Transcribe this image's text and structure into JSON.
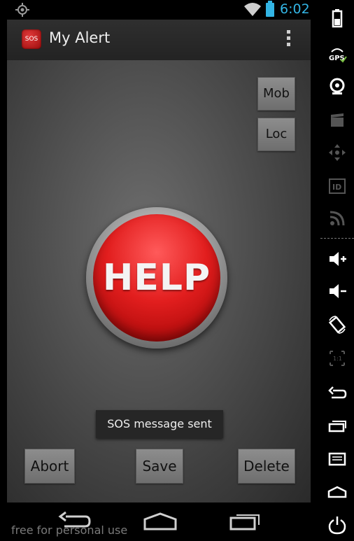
{
  "status_bar": {
    "time": "6:02"
  },
  "app": {
    "title": "My Alert",
    "icon_label": "SOS"
  },
  "buttons": {
    "mob": "Mob",
    "loc": "Loc",
    "help": "HELP",
    "abort": "Abort",
    "save": "Save",
    "delete": "Delete"
  },
  "toast": {
    "message": "SOS message sent"
  },
  "watermark": "free for personal use",
  "sidebar": {
    "gps_label": "GPS",
    "id_label": "ID",
    "scale_label": "1:1"
  },
  "icons": [
    "location-icon",
    "wifi-icon",
    "battery-icon",
    "overflow-menu-icon",
    "back-icon",
    "home-icon",
    "recents-icon",
    "battery-side-icon",
    "gps-icon",
    "camera-icon",
    "video-icon",
    "dpad-icon",
    "id-icon",
    "rss-icon",
    "volume-up-icon",
    "volume-down-icon",
    "rotate-icon",
    "scale-icon",
    "back-side-icon",
    "recents-side-icon",
    "menu-side-icon",
    "home-side-icon",
    "power-icon"
  ],
  "colors": {
    "accent": "#33b5e5",
    "help_red": "#e21e1e"
  }
}
